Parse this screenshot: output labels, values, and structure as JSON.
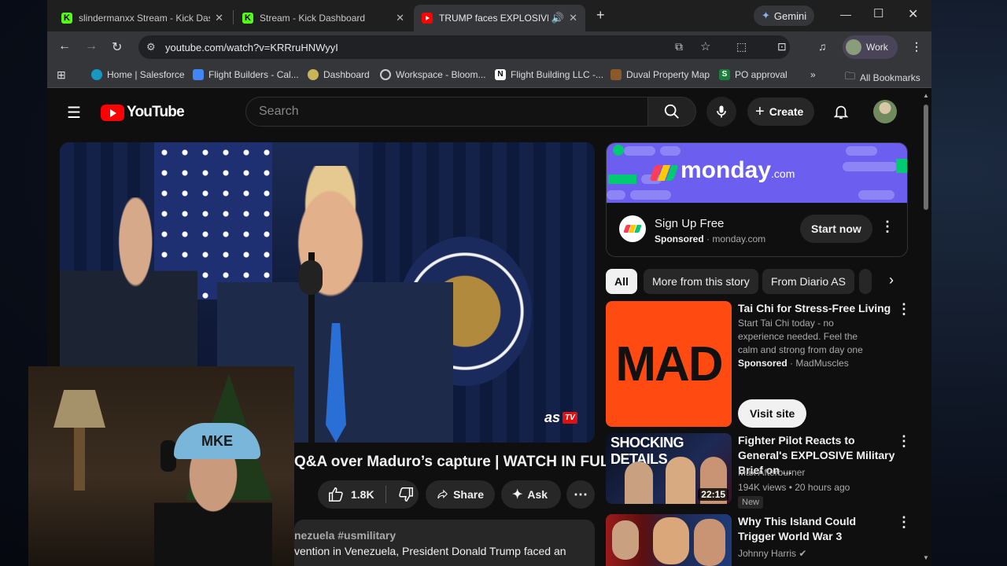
{
  "browser": {
    "tabs": [
      {
        "title": "slindermanxx Stream - Kick Dashboard",
        "favicon": "kick-icon"
      },
      {
        "title": "Stream - Kick Dashboard",
        "favicon": "kick-icon"
      },
      {
        "title": "TRUMP faces EXPLOSIVE PRESS",
        "favicon": "youtube-icon"
      }
    ],
    "gemini_label": "Gemini",
    "url": "youtube.com/watch?v=KRRruHNWyyI",
    "profile_label": "Work",
    "bookmarks": [
      "Home | Salesforce",
      "Flight Builders - Cal...",
      "Dashboard",
      "Workspace - Bloom...",
      "Flight Building LLC -...",
      "Duval Property Map",
      "PO approval"
    ],
    "all_bookmarks_label": "All Bookmarks"
  },
  "youtube": {
    "logo_text": "YouTube",
    "search_placeholder": "Search",
    "create_label": "Create",
    "player": {
      "watermark": "as",
      "watermark_badge": "TV"
    },
    "video_title": "Q&A over Maduro’s capture | WATCH IN FULL",
    "likes": "1.8K",
    "share_label": "Share",
    "ask_label": "Ask",
    "description_tags": "nezuela #usmilitary",
    "description_text": "vention in Venezuela, President Donald Trump faced an"
  },
  "sidebar": {
    "ad": {
      "brand": "monday",
      "brand_suffix": ".com",
      "title": "Sign Up Free",
      "sponsored_label": "Sponsored",
      "domain": "monday.com",
      "cta": "Start now"
    },
    "chips": [
      "All",
      "More from this story",
      "From Diario AS"
    ],
    "cards": [
      {
        "title": "Tai Chi for Stress-Free Living",
        "description": "Start Tai Chi today - no experience needed. Feel the calm and strong from day one",
        "sponsored_label": "Sponsored",
        "advertiser": "MadMuscles",
        "cta": "Visit site",
        "thumb_text": "MAD"
      },
      {
        "title": "Fighter Pilot Reacts to General's EXPLOSIVE Military Brief on ...",
        "channel": "Max Afterburner",
        "stats": "194K views • 20 hours ago",
        "badge": "New",
        "duration": "22:15",
        "thumb_text": "SHOCKING DETAILS"
      },
      {
        "title": "Why This Island Could Trigger World War 3",
        "channel": "Johnny Harris"
      }
    ]
  },
  "webcam": {
    "cap_text": "MKE"
  },
  "colors": {
    "yt_red": "#ff0000",
    "kick_green": "#53fc18",
    "monday_purple": "#6c5ff0",
    "mad_orange": "#ff4b12"
  }
}
